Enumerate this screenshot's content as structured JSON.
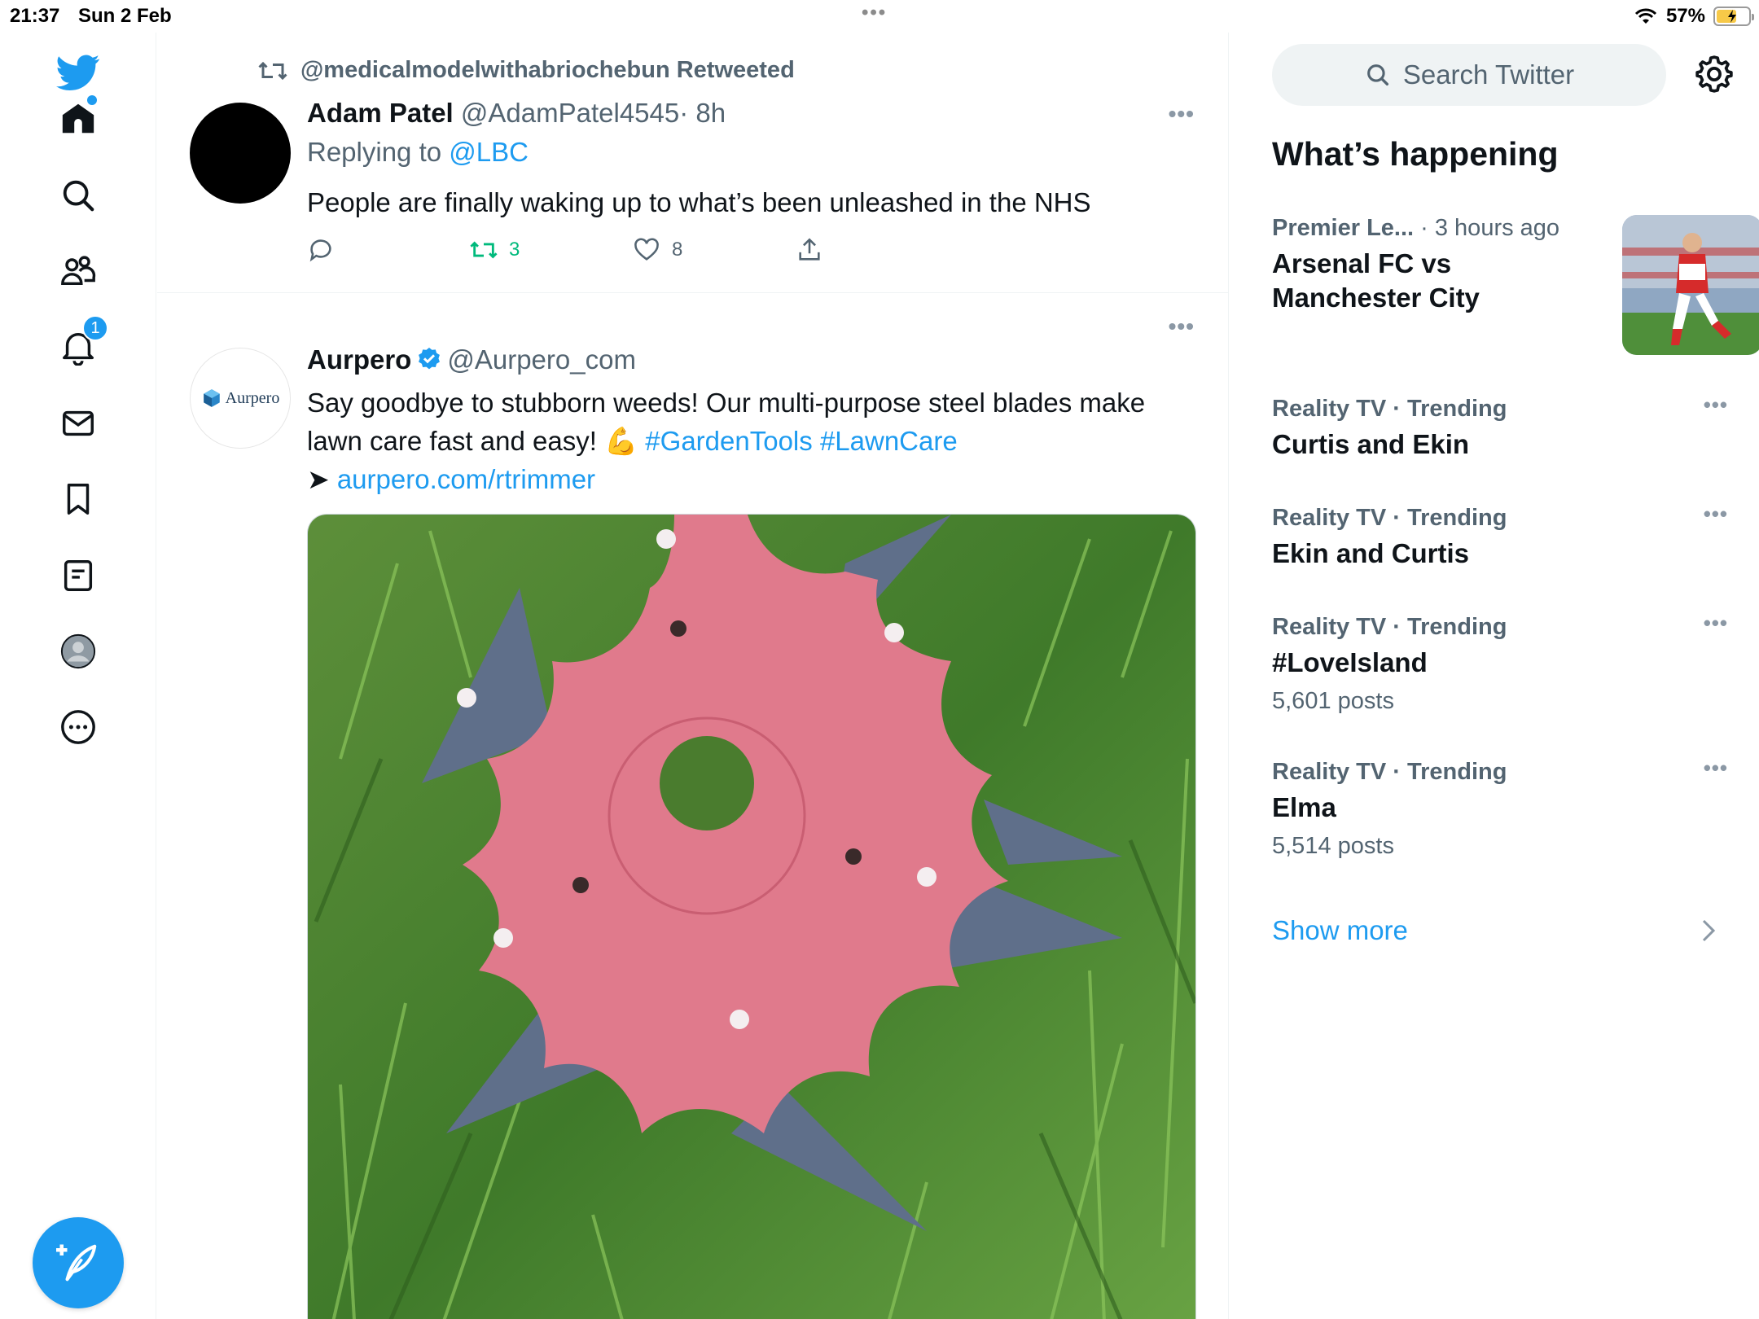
{
  "status_bar": {
    "time": "21:37",
    "date": "Sun 2 Feb",
    "battery": "57%"
  },
  "nav": {
    "notifications_badge": "1",
    "items": [
      "twitter-logo-icon",
      "home-icon",
      "search-icon",
      "communities-icon",
      "notifications-icon",
      "messages-icon",
      "bookmarks-icon",
      "lists-icon",
      "profile-icon",
      "more-icon"
    ]
  },
  "tweet1": {
    "retweet_label": "@medicalmodelwithabriochebun Retweeted",
    "name": "Adam Patel",
    "handle": "@AdamPatel4545",
    "time": "· 8h",
    "replying_prefix": "Replying to",
    "replying_to": "@LBC",
    "text": "People are finally waking up to what’s been unleashed in the NHS",
    "retweets": "3",
    "likes": "8"
  },
  "tweet2": {
    "avatar_text": "Aurpero",
    "name": "Aurpero",
    "handle": "@Aurpero_com",
    "text_line1": "Say goodbye to stubborn weeds! Our multi-purpose steel blades make",
    "text_line2a": "lawn care fast and easy! 💪",
    "hashtag1": "#GardenTools",
    "hashtag2": "#LawnCare",
    "arrow": "➤",
    "link": "aurpero.com/rtrimmer"
  },
  "sidebar": {
    "search_placeholder": "Search Twitter",
    "whats_happening": "What’s happening",
    "featured": {
      "source": "Premier Le...",
      "time": "· 3 hours ago",
      "title_line1": "Arsenal FC vs",
      "title_line2": "Manchester City"
    },
    "trends": [
      {
        "context": "Reality TV · Trending",
        "title": "Curtis and Ekin",
        "count": ""
      },
      {
        "context": "Reality TV · Trending",
        "title": "Ekin and Curtis",
        "count": ""
      },
      {
        "context": "Reality TV · Trending",
        "title": "#LoveIsland",
        "count": "5,601 posts"
      },
      {
        "context": "Reality TV · Trending",
        "title": "Elma",
        "count": "5,514 posts"
      }
    ],
    "show_more": "Show more"
  },
  "colors": {
    "accent": "#1d9bf0",
    "retweet_green": "#00ba7c",
    "text_secondary": "#536471",
    "text_primary": "#0f1419"
  }
}
